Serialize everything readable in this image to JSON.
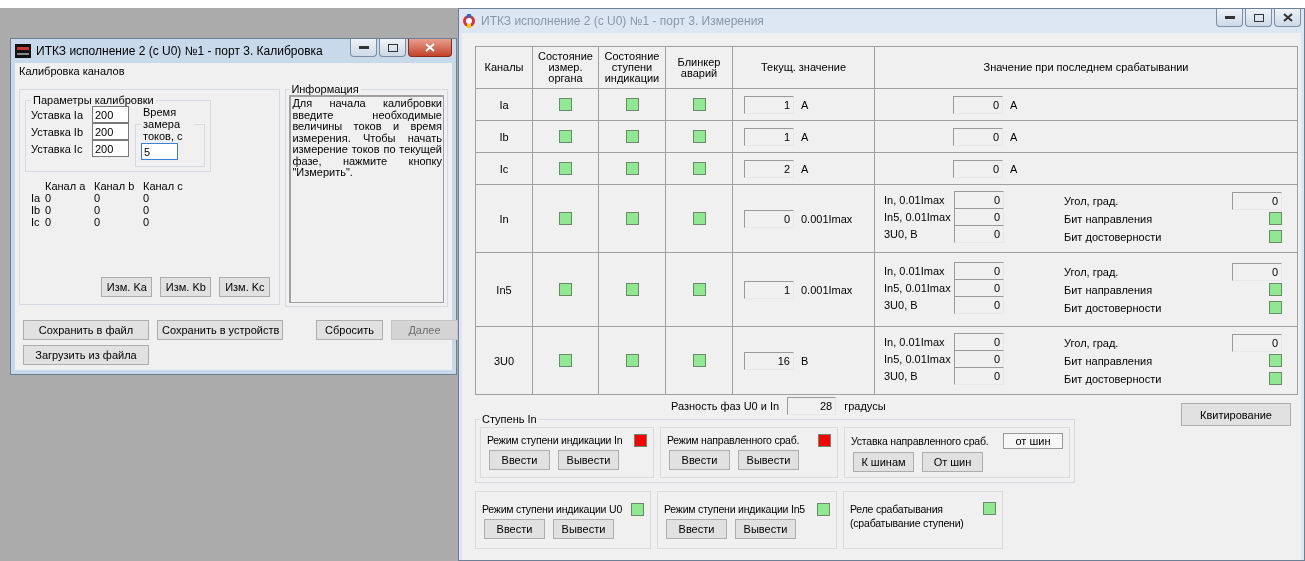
{
  "calib_window": {
    "title": "ИТКЗ исполнение 2 (с U0) №1 - порт 3. Калибровка",
    "active": true,
    "section_title": "Калибровка каналов",
    "params_group": {
      "title": "Параметры калибровки",
      "fields": [
        {
          "label": "Уставка Ia",
          "value": "200"
        },
        {
          "label": "Уставка Ib",
          "value": "200"
        },
        {
          "label": "Уставка Ic",
          "value": "200"
        }
      ]
    },
    "time_group": {
      "title": "Время замера токов, с",
      "value": "5"
    },
    "results": {
      "columns": [
        "Канал a",
        "Канал b",
        "Канал c"
      ],
      "rows": [
        {
          "label": "Ia",
          "values": [
            "0",
            "0",
            "0"
          ]
        },
        {
          "label": "Ib",
          "values": [
            "0",
            "0",
            "0"
          ]
        },
        {
          "label": "Ic",
          "values": [
            "0",
            "0",
            "0"
          ]
        }
      ]
    },
    "measure_buttons": [
      "Изм. Ka",
      "Изм. Kb",
      "Изм. Kc"
    ],
    "info": {
      "title": "Информация",
      "text": "Для начала калибровки введите необходимые величины токов и время измерения. Чтобы начать измерение токов по текущей фазе, нажмите кнопку \"Измерить\"."
    },
    "buttons": [
      {
        "label": "Сохранить в файл",
        "disabled": false
      },
      {
        "label": "Сохранить в устройств",
        "disabled": false
      },
      {
        "label": "Сбросить",
        "disabled": false
      },
      {
        "label": "Далее",
        "disabled": true
      },
      {
        "label": "Загрузить из файла",
        "disabled": false
      }
    ]
  },
  "meas_window": {
    "title": "ИТКЗ исполнение 2 (с U0) №1 - порт 3. Измерения",
    "active": false,
    "table": {
      "columns": [
        "Каналы",
        "Состояние измер. органа",
        "Состояние ступени индикации",
        "Блинкер аварий",
        "Текущ. значение",
        "Значение при последнем срабатывании"
      ],
      "rows": [
        {
          "kind": "simple",
          "channel": "Ia",
          "lamps": [
            {
              "color": "#90e890"
            },
            {
              "color": "#90e890"
            },
            {
              "color": "#90e890"
            }
          ],
          "value": "1",
          "unit": "A",
          "last_value": "0",
          "last_unit": "A"
        },
        {
          "kind": "simple",
          "channel": "Ib",
          "lamps": [
            {
              "color": "#90e890"
            },
            {
              "color": "#90e890"
            },
            {
              "color": "#90e890"
            }
          ],
          "value": "1",
          "unit": "A",
          "last_value": "0",
          "last_unit": "A"
        },
        {
          "kind": "simple",
          "channel": "Ic",
          "lamps": [
            {
              "color": "#90e890"
            },
            {
              "color": "#90e890"
            },
            {
              "color": "#90e890"
            }
          ],
          "value": "2",
          "unit": "A",
          "last_value": "0",
          "last_unit": "A"
        },
        {
          "kind": "detail",
          "channel": "In",
          "lamps": [
            {
              "color": "#90e890"
            },
            {
              "color": "#90e890"
            },
            {
              "color": "#90e890"
            }
          ],
          "value": "0",
          "unit": "0.001Imax",
          "fields": [
            {
              "label": "In, 0.01Imax",
              "value": "0"
            },
            {
              "label": "In5, 0.01Imax",
              "value": "0"
            },
            {
              "label": "3U0, B",
              "value": "0"
            }
          ],
          "angle": {
            "label": "Угол, град.",
            "value": "0"
          },
          "flags": [
            {
              "label": "Бит направления",
              "color": "#90e890"
            },
            {
              "label": "Бит достоверности",
              "color": "#90e890"
            }
          ]
        },
        {
          "kind": "detail",
          "channel": "In5",
          "lamps": [
            {
              "color": "#90e890"
            },
            {
              "color": "#90e890"
            },
            {
              "color": "#90e890"
            }
          ],
          "value": "1",
          "unit": "0.001Imax",
          "fields": [
            {
              "label": "In, 0.01Imax",
              "value": "0"
            },
            {
              "label": "In5, 0.01Imax",
              "value": "0"
            },
            {
              "label": "3U0, B",
              "value": "0"
            }
          ],
          "angle": {
            "label": "Угол, град.",
            "value": "0"
          },
          "flags": [
            {
              "label": "Бит направления",
              "color": "#90e890"
            },
            {
              "label": "Бит достоверности",
              "color": "#90e890"
            }
          ]
        },
        {
          "kind": "detail",
          "channel": "3U0",
          "lamps": [
            {
              "color": "#90e890"
            },
            {
              "color": "#90e890"
            },
            {
              "color": "#90e890"
            }
          ],
          "value": "16",
          "unit": "B",
          "fields": [
            {
              "label": "In, 0.01Imax",
              "value": "0"
            },
            {
              "label": "In5, 0.01Imax",
              "value": "0"
            },
            {
              "label": "3U0, B",
              "value": "0"
            }
          ],
          "angle": {
            "label": "Угол, град.",
            "value": "0"
          },
          "flags": [
            {
              "label": "Бит направления",
              "color": "#90e890"
            },
            {
              "label": "Бит достоверности",
              "color": "#90e890"
            }
          ]
        }
      ]
    },
    "phase_diff": {
      "label": "Разность фаз U0 и In",
      "value": "28",
      "unit": "градусы"
    },
    "ack_button": "Квитирование",
    "stage_group": {
      "title": "Ступень In",
      "panels": [
        {
          "kind": "mode",
          "label": "Режим ступени индикации In",
          "color": "#ff0000",
          "buttons": [
            "Ввести",
            "Вывести"
          ]
        },
        {
          "kind": "mode",
          "label": "Режим направленного сраб.",
          "color": "#ff0000",
          "buttons": [
            "Ввести",
            "Вывести"
          ]
        },
        {
          "kind": "setpoint",
          "label": "Уставка направленного сраб.",
          "value": "от шин",
          "buttons": [
            "К шинам",
            "От шин"
          ]
        }
      ]
    },
    "panels": [
      {
        "kind": "mode",
        "label": "Режим ступени индикации U0",
        "color": "#90e890",
        "buttons": [
          "Ввести",
          "Вывести"
        ]
      },
      {
        "kind": "mode",
        "label": "Режим ступени индикации In5",
        "color": "#90e890",
        "buttons": [
          "Ввести",
          "Вывести"
        ]
      },
      {
        "kind": "relay",
        "label": "Реле срабатывания\n(срабатывание ступени)",
        "color": "#90e890"
      }
    ]
  }
}
